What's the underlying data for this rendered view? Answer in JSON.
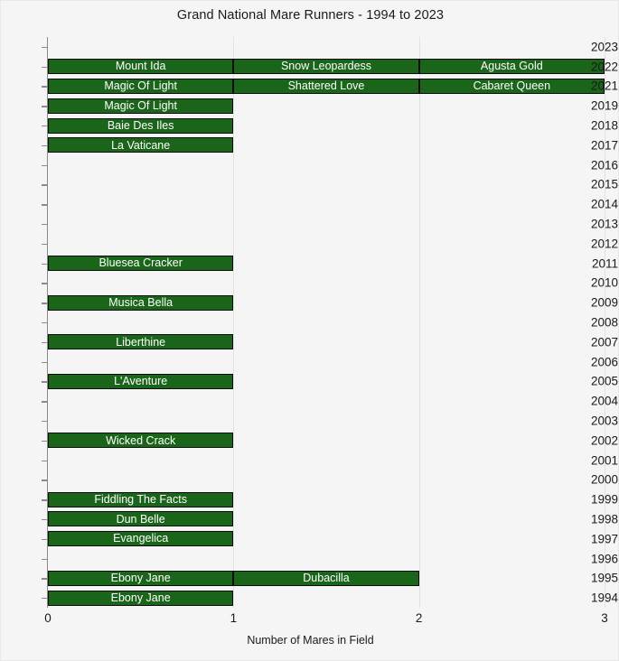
{
  "chart_data": {
    "type": "bar",
    "orientation": "horizontal",
    "stacked": true,
    "title": "Grand National Mare Runners - 1994 to 2023",
    "xlabel": "Number of Mares in Field",
    "ylabel": "",
    "xlim": [
      0,
      3
    ],
    "xticks": [
      "0",
      "1",
      "2",
      "3"
    ],
    "grid": true,
    "legend": "none",
    "bar_color": "#1b651b",
    "bar_edge_color": "#0d0d0d",
    "bar_label_color": "#ffffff",
    "background_color": "#f5f5f5",
    "categories": [
      "2023",
      "2022",
      "2021",
      "2019",
      "2018",
      "2017",
      "2016",
      "2015",
      "2014",
      "2013",
      "2012",
      "2011",
      "2010",
      "2009",
      "2008",
      "2007",
      "2006",
      "2005",
      "2004",
      "2003",
      "2002",
      "2001",
      "2000",
      "1999",
      "1998",
      "1997",
      "1996",
      "1995",
      "1994"
    ],
    "values": [
      0,
      3,
      3,
      1,
      1,
      1,
      0,
      0,
      0,
      0,
      0,
      1,
      0,
      1,
      0,
      1,
      0,
      1,
      0,
      0,
      1,
      0,
      0,
      1,
      1,
      1,
      0,
      2,
      1
    ],
    "rows": [
      {
        "year": "2023",
        "count": 0,
        "mares": []
      },
      {
        "year": "2022",
        "count": 3,
        "mares": [
          "Mount Ida",
          "Snow Leopardess",
          "Agusta Gold"
        ]
      },
      {
        "year": "2021",
        "count": 3,
        "mares": [
          "Magic Of Light",
          "Shattered Love",
          "Cabaret Queen"
        ]
      },
      {
        "year": "2019",
        "count": 1,
        "mares": [
          "Magic Of Light"
        ]
      },
      {
        "year": "2018",
        "count": 1,
        "mares": [
          "Baie Des Iles"
        ]
      },
      {
        "year": "2017",
        "count": 1,
        "mares": [
          "La Vaticane"
        ]
      },
      {
        "year": "2016",
        "count": 0,
        "mares": []
      },
      {
        "year": "2015",
        "count": 0,
        "mares": []
      },
      {
        "year": "2014",
        "count": 0,
        "mares": []
      },
      {
        "year": "2013",
        "count": 0,
        "mares": []
      },
      {
        "year": "2012",
        "count": 0,
        "mares": []
      },
      {
        "year": "2011",
        "count": 1,
        "mares": [
          "Bluesea Cracker"
        ]
      },
      {
        "year": "2010",
        "count": 0,
        "mares": []
      },
      {
        "year": "2009",
        "count": 1,
        "mares": [
          "Musica Bella"
        ]
      },
      {
        "year": "2008",
        "count": 0,
        "mares": []
      },
      {
        "year": "2007",
        "count": 1,
        "mares": [
          "Liberthine"
        ]
      },
      {
        "year": "2006",
        "count": 0,
        "mares": []
      },
      {
        "year": "2005",
        "count": 1,
        "mares": [
          "L'Aventure"
        ]
      },
      {
        "year": "2004",
        "count": 0,
        "mares": []
      },
      {
        "year": "2003",
        "count": 0,
        "mares": []
      },
      {
        "year": "2002",
        "count": 1,
        "mares": [
          "Wicked Crack"
        ]
      },
      {
        "year": "2001",
        "count": 0,
        "mares": []
      },
      {
        "year": "2000",
        "count": 0,
        "mares": []
      },
      {
        "year": "1999",
        "count": 1,
        "mares": [
          "Fiddling The Facts"
        ]
      },
      {
        "year": "1998",
        "count": 1,
        "mares": [
          "Dun Belle"
        ]
      },
      {
        "year": "1997",
        "count": 1,
        "mares": [
          "Evangelica"
        ]
      },
      {
        "year": "1996",
        "count": 0,
        "mares": []
      },
      {
        "year": "1995",
        "count": 2,
        "mares": [
          "Ebony Jane",
          "Dubacilla"
        ]
      },
      {
        "year": "1994",
        "count": 1,
        "mares": [
          "Ebony Jane"
        ]
      }
    ]
  }
}
